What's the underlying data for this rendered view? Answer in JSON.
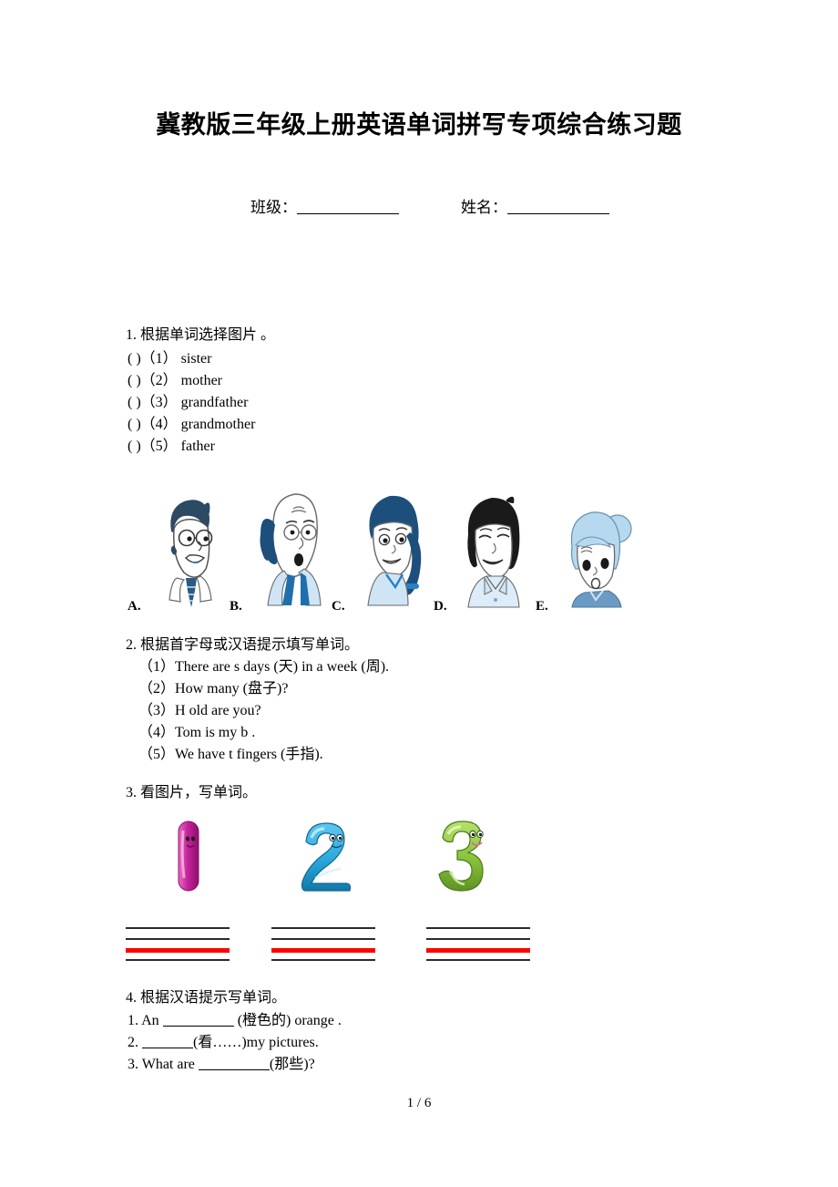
{
  "document": {
    "title": "冀教版三年级上册英语单词拼写专项综合练习题",
    "footer": "1 / 6"
  },
  "header_fields": {
    "class_label": "班级：",
    "name_label": "姓名："
  },
  "sections": [
    {
      "id": "section-1",
      "heading": "1. 根据单词选择图片 。",
      "items": [
        {
          "marker": "( )（1）",
          "text": "sister"
        },
        {
          "marker": "( )（2）",
          "text": "mother"
        },
        {
          "marker": "( )（3）",
          "text": "grandfather"
        },
        {
          "marker": "( )（4）",
          "text": "grandmother"
        },
        {
          "marker": "( )（5）",
          "text": "father"
        }
      ],
      "pictures": [
        {
          "letter": "A.",
          "icon": "father-portrait-icon",
          "desc": "man with dark blue hair, glasses and tie"
        },
        {
          "letter": "B.",
          "icon": "grandfather-portrait-icon",
          "desc": "balding elderly man with glasses"
        },
        {
          "letter": "C.",
          "icon": "sister-portrait-icon",
          "desc": "young girl with dark ponytail"
        },
        {
          "letter": "D.",
          "icon": "mother-portrait-icon",
          "desc": "woman with black bob hair"
        },
        {
          "letter": "E.",
          "icon": "grandmother-portrait-icon",
          "desc": "elderly woman with light blue hair bun"
        }
      ]
    },
    {
      "id": "section-2",
      "heading": "2. 根据首字母或汉语提示填写单词。",
      "items": [
        {
          "marker": "（1）",
          "text": "There are s      days (天) in a week (周)."
        },
        {
          "marker": "（2）",
          "text": "How many      (盘子)?"
        },
        {
          "marker": "（3）",
          "text": "H    old are you?"
        },
        {
          "marker": "（4）",
          "text": "Tom is my b   ."
        },
        {
          "marker": "（5）",
          "text": "We have t     fingers (手指)."
        }
      ]
    },
    {
      "id": "section-3",
      "heading": "3. 看图片，写单词。",
      "numbers": [
        {
          "value": "1",
          "color": "#c4249b"
        },
        {
          "value": "2",
          "color": "#29a8dd"
        },
        {
          "value": "3",
          "color": "#8cc63f"
        }
      ],
      "writing_lines": 3
    },
    {
      "id": "section-4",
      "heading": "4. 根据汉语提示写单词。",
      "items": [
        {
          "marker": "1.",
          "text_before": "An ",
          "blank_width": 78,
          "text_after": " (橙色的) orange ."
        },
        {
          "marker": "2.",
          "text_before": "",
          "blank_width": 56,
          "text_after": "(看……)my pictures."
        },
        {
          "marker": "3.",
          "text_before": "What are ",
          "blank_width": 78,
          "text_after": "(那些)?"
        }
      ]
    }
  ],
  "colors": {
    "rule_black": "#2b2b2b",
    "rule_red": "#ff0000",
    "hair_dark_blue": "#1d4f7c",
    "skin": "#ffffff",
    "shirt_light_blue": "#cfe5f5",
    "hair_black": "#1a1a1a",
    "hair_light_blue": "#b6d9ef"
  }
}
